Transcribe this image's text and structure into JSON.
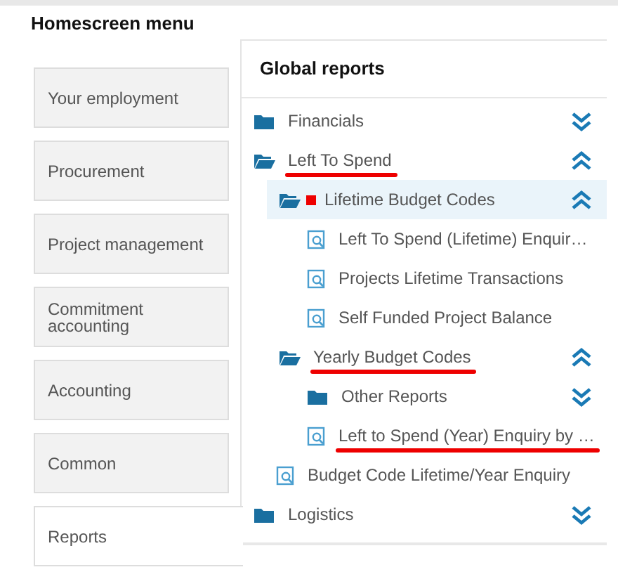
{
  "menu": {
    "title": "Homescreen menu",
    "items": [
      {
        "label": "Your employment",
        "selected": false
      },
      {
        "label": "Procurement",
        "selected": false
      },
      {
        "label": "Project management",
        "selected": false
      },
      {
        "label": "Commitment accounting",
        "selected": false
      },
      {
        "label": "Accounting",
        "selected": false
      },
      {
        "label": "Common",
        "selected": false
      },
      {
        "label": "Reports",
        "selected": true
      }
    ]
  },
  "reports": {
    "title": "Global reports",
    "tree": [
      {
        "kind": "folder",
        "label": "Financials",
        "expanded": false,
        "selected": false,
        "underlined": false,
        "flagged": false
      },
      {
        "kind": "folder",
        "label": "Left To Spend",
        "expanded": true,
        "selected": false,
        "underlined": true,
        "flagged": false,
        "children": [
          {
            "kind": "folder",
            "label": "Lifetime Budget Codes",
            "expanded": true,
            "selected": true,
            "underlined": false,
            "flagged": true,
            "children": [
              {
                "kind": "report",
                "label": "Left To Spend (Lifetime) Enquir…",
                "selected": false,
                "underlined": false,
                "flagged": false
              },
              {
                "kind": "report",
                "label": "Projects Lifetime Transactions",
                "selected": false,
                "underlined": false,
                "flagged": false
              },
              {
                "kind": "report",
                "label": "Self Funded Project Balance",
                "selected": false,
                "underlined": false,
                "flagged": false
              }
            ]
          },
          {
            "kind": "folder",
            "label": "Yearly Budget Codes",
            "expanded": true,
            "selected": false,
            "underlined": true,
            "flagged": false,
            "children": [
              {
                "kind": "folder",
                "label": "Other Reports",
                "expanded": false,
                "selected": false,
                "underlined": false,
                "flagged": false
              },
              {
                "kind": "report",
                "label": "Left to Spend (Year) Enquiry by …",
                "selected": false,
                "underlined": true,
                "flagged": false
              }
            ]
          },
          {
            "kind": "report",
            "label": "Budget Code Lifetime/Year Enquiry",
            "selected": false,
            "underlined": false,
            "flagged": false
          }
        ]
      },
      {
        "kind": "folder",
        "label": "Logistics",
        "expanded": false,
        "selected": false,
        "underlined": false,
        "flagged": false
      }
    ]
  }
}
